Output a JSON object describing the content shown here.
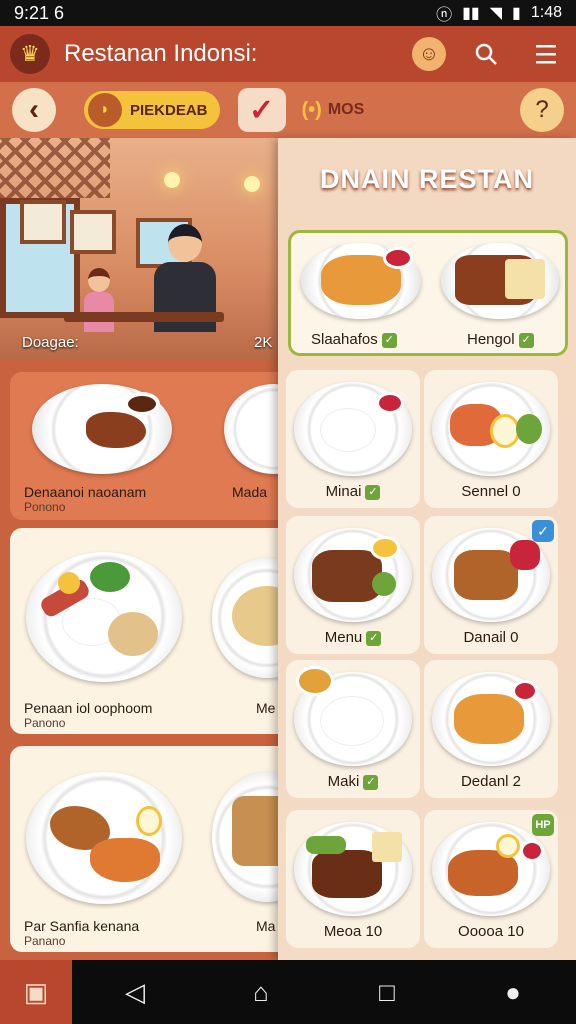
{
  "status_bar": {
    "time": "9:21 6",
    "clock": "1:48",
    "battery_icon": "battery-icon",
    "signal_icon": "signal-icon",
    "wifi_icon": "wifi-icon"
  },
  "header": {
    "title": "Restanan Indonsi:"
  },
  "toolbar": {
    "chip_label": "PIEKDEAB",
    "music_label": "MOS"
  },
  "hero": {
    "caption_left": "Doagae:",
    "caption_right": "2K"
  },
  "left_cards": [
    {
      "title": "Denaanoi naoanam",
      "subtitle": "Ponono",
      "side": "Mada"
    },
    {
      "title": "Penaan iol oophoom",
      "subtitle": "Panono",
      "side": "Me"
    },
    {
      "title": "Par Sanfia kenana",
      "subtitle": "Panano",
      "side": "Ma"
    }
  ],
  "panel": {
    "title": "DNAIN RESTAN",
    "featured": [
      {
        "label": "Slaahafos"
      },
      {
        "label": "Hengol"
      }
    ],
    "tiles": [
      {
        "label": "Minai",
        "check": true
      },
      {
        "label": "Sennel 0",
        "check": false
      },
      {
        "label": "Menu",
        "check": true
      },
      {
        "label": "Danail 0",
        "check": false
      },
      {
        "label": "Maki",
        "check": true
      },
      {
        "label": "Dedanl 2",
        "check": false
      },
      {
        "label": "Meoa 10",
        "check": false
      },
      {
        "label": "Ooooa 10",
        "check": false
      }
    ],
    "badge_hp": "HP"
  },
  "colors": {
    "header": "#b9472e",
    "toolbar": "#d3704c",
    "panel": "#f4d9c2",
    "accent_green": "#9ab83c",
    "chip": "#f5c33b"
  }
}
